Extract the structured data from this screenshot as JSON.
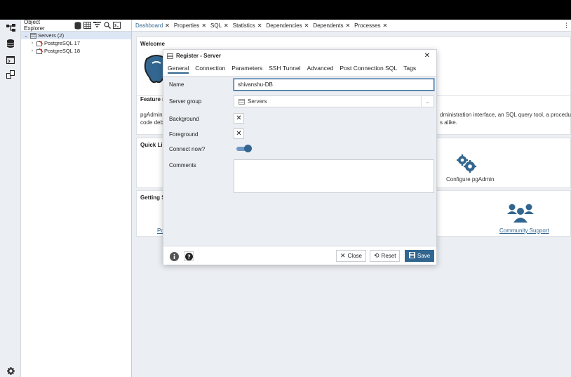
{
  "explorer": {
    "title": "Object Explorer",
    "tree": [
      {
        "label": "Servers (2)",
        "expanded": true
      },
      {
        "label": "PostgreSQL 17",
        "expanded": false
      },
      {
        "label": "PostgreSQL 18",
        "expanded": false
      }
    ]
  },
  "tabs": [
    {
      "label": "Dashboard",
      "active": true
    },
    {
      "label": "Properties"
    },
    {
      "label": "SQL"
    },
    {
      "label": "Statistics"
    },
    {
      "label": "Dependencies"
    },
    {
      "label": "Dependents"
    },
    {
      "label": "Processes"
    }
  ],
  "tabs_more": "⋮",
  "dashboard": {
    "welcome_title": "Welcome",
    "features_title": "Feature ri",
    "features_text_left_1": "pgAdmin",
    "features_text_left_2": "code debu",
    "features_text_right_1": "dministration interface, an SQL query tool, a procedural",
    "features_text_right_2": "s alike.",
    "quick_links_title": "Quick Lin",
    "configure_label": "Configure pgAdmin",
    "getting_started_title": "Getting St",
    "po_link": "Po",
    "community_link": "Community Support"
  },
  "dialog": {
    "title": "Register - Server",
    "tabs": [
      "General",
      "Connection",
      "Parameters",
      "SSH Tunnel",
      "Advanced",
      "Post Connection SQL",
      "Tags"
    ],
    "active_tab": "General",
    "fields": {
      "name_label": "Name",
      "name_value": "shivanshu-DB",
      "server_group_label": "Server group",
      "server_group_value": "Servers",
      "background_label": "Background",
      "foreground_label": "Foreground",
      "connect_now_label": "Connect now?",
      "connect_now_value": true,
      "comments_label": "Comments",
      "comments_value": ""
    },
    "footer": {
      "close_label": "Close",
      "reset_label": "Reset",
      "save_label": "Save"
    }
  },
  "colors": {
    "accent": "#326690",
    "toggle_track": "#6d97c4",
    "background": "#ebeef3"
  }
}
